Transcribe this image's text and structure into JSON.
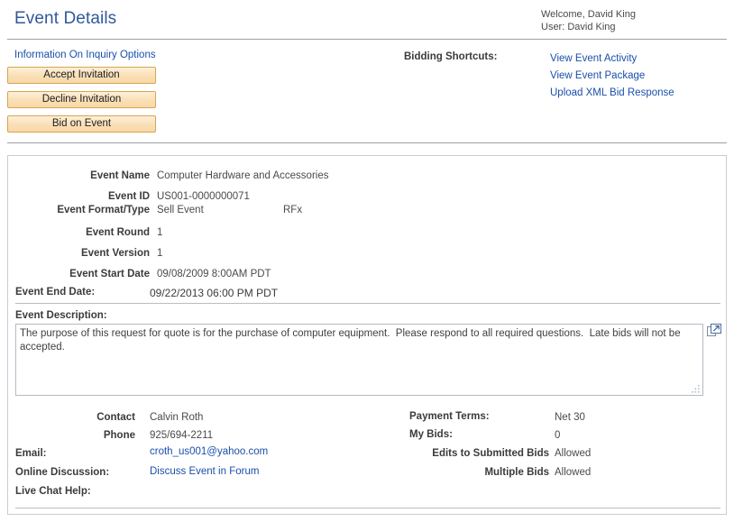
{
  "header": {
    "title": "Event Details",
    "welcome": "Welcome, David King",
    "user": "User: David King"
  },
  "actions": {
    "inquiry_options_link": "Information On Inquiry Options",
    "accept_label": "Accept Invitation",
    "decline_label": "Decline Invitation",
    "bid_label": "Bid on Event"
  },
  "shortcuts": {
    "label": "Bidding Shortcuts:",
    "links": [
      "View Event Activity",
      "View Event Package",
      "Upload XML Bid Response"
    ]
  },
  "details": {
    "event_name_label": "Event Name",
    "event_name_value": "Computer Hardware and Accessories",
    "event_id_label": "Event ID",
    "event_id_value": "US001-0000000071",
    "event_format_label": "Event Format/Type",
    "event_format_value": "Sell Event",
    "event_type_value": "RFx",
    "event_round_label": "Event Round",
    "event_round_value": "1",
    "event_version_label": "Event Version",
    "event_version_value": "1",
    "event_start_label": "Event Start Date",
    "event_start_value": "09/08/2009  8:00AM PDT",
    "event_end_label": "Event End Date:",
    "event_end_value": "09/22/2013 06:00 PM PDT"
  },
  "description": {
    "label": "Event Description:",
    "text": "The purpose of this request for quote is for the purchase of computer equipment.  Please respond to all required questions.  Late bids will not be accepted.",
    "expand_icon": "expand-popout-icon",
    "resize_icon": "resize-grip-icon"
  },
  "contact": {
    "contact_label": "Contact",
    "contact_value": "Calvin Roth",
    "phone_label": "Phone",
    "phone_value": "925/694-2211",
    "email_label": "Email:",
    "email_value": "croth_us001@yahoo.com",
    "discussion_label": "Online Discussion:",
    "discussion_value": "Discuss Event in Forum",
    "chat_label": "Live Chat Help:"
  },
  "terms": {
    "payment_terms_label": "Payment Terms:",
    "payment_terms_value": "Net 30",
    "my_bids_label": "My Bids:",
    "my_bids_value": "0",
    "edits_label": "Edits to Submitted Bids",
    "edits_value": "Allowed",
    "multiple_label": "Multiple Bids",
    "multiple_value": "Allowed"
  },
  "colors": {
    "title_blue": "#31589c",
    "link_blue": "#1a4faa",
    "button_border": "#d9a44f",
    "button_fill": "#fae0b8",
    "panel_border": "#c9cdd2"
  }
}
